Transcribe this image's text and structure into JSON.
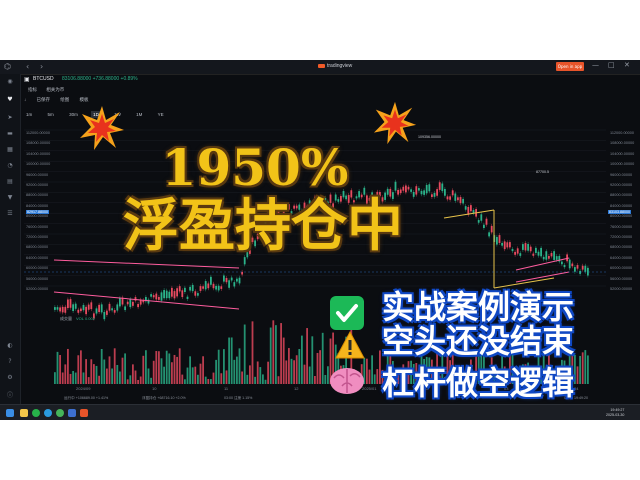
{
  "window": {
    "app_name": "tradingview",
    "open_button": "Open in app",
    "controls": [
      "—",
      "□",
      "✕"
    ]
  },
  "symbol": {
    "ticker": "BTCUSD",
    "price_line": "83106.88000 +736.88000 +0.89%"
  },
  "tabs": [
    "指标",
    "相关为币"
  ],
  "toolbar": [
    "↓",
    "已保存",
    "绘图",
    "模板"
  ],
  "intervals": [
    "1m",
    "5m",
    "30m",
    "1D",
    "1W",
    "1M",
    "YE"
  ],
  "active_interval": "1D",
  "y_axis_left": [
    "112000.00000",
    "108000.00000",
    "104000.00000",
    "100000.00000",
    "96000.00000",
    "92000.00000",
    "88000.00000",
    "84000.00000",
    "80000.00000",
    "76000.00000",
    "72000.00000",
    "68000.00000",
    "64000.00000",
    "60000.00000",
    "56000.00000",
    "52000.00000"
  ],
  "y_axis_right": [
    "112000.00000",
    "108000.00000",
    "104000.00000",
    "100000.00000",
    "96000.00000",
    "92000.00000",
    "88000.00000",
    "84000.00000",
    "80000.00000",
    "76000.00000",
    "72000.00000",
    "68000.00000",
    "64000.00000",
    "60000.00000",
    "56000.00000",
    "52000.00000"
  ],
  "price_tags": {
    "left": "82917.88000",
    "right": "83103.88000",
    "peak": "109356.00000",
    "mid": "87700.5"
  },
  "volume": {
    "label": "成交量",
    "value": "VOL 0.002"
  },
  "x_axis": [
    "2024/09",
    "10",
    "11",
    "12",
    "2025/01",
    "02",
    "03",
    "04"
  ],
  "status": {
    "left": "运行中  +106689.00  +1.41%",
    "mid": "浮盈持仓  +68716.10  +2.0%",
    "right": "03:00  注册  1.15%",
    "clock": "03/30 19:49:20"
  },
  "taskbar": {
    "time": "19:49:27",
    "date": "2025-03-30"
  },
  "overlay": {
    "headline_1": "1950%",
    "headline_2": "浮盈持仓中",
    "point_1": "实战案例演示",
    "point_2": "空头还没结束",
    "point_3": "杠杆做空逻辑",
    "headline_color": "#f2c318",
    "point_color": "#ffffff",
    "point_outline": "#1149c4"
  },
  "icons": [
    "check-icon",
    "warning-icon",
    "brain-icon",
    "explosion-icon"
  ]
}
